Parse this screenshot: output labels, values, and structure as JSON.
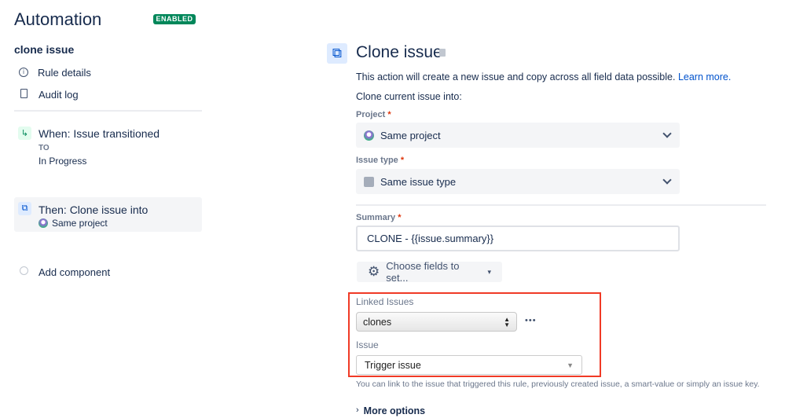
{
  "header": {
    "title": "Automation",
    "status_badge": "ENABLED"
  },
  "sidebar": {
    "rule_name": "clone issue",
    "nav": [
      {
        "label": "Rule details",
        "icon": "info-icon"
      },
      {
        "label": "Audit log",
        "icon": "document-icon"
      }
    ],
    "trigger": {
      "title": "When: Issue transitioned",
      "sub_label": "TO",
      "sub_value": "In Progress"
    },
    "action": {
      "title": "Then: Clone issue into",
      "project": "Same project"
    },
    "add_component": "Add component"
  },
  "main": {
    "title": "Clone issue",
    "description": "This action will create a new issue and copy across all field data possible.",
    "learn_more": "Learn more.",
    "clone_into": "Clone current issue into:",
    "project": {
      "label": "Project",
      "required": "*",
      "value": "Same project"
    },
    "issue_type": {
      "label": "Issue type",
      "required": "*",
      "value": "Same issue type"
    },
    "summary": {
      "label": "Summary",
      "required": "*",
      "value": "CLONE - {{issue.summary}}"
    },
    "choose_fields": "Choose fields to set...",
    "linked_issues": {
      "label": "Linked Issues",
      "value": "clones",
      "more": "•••"
    },
    "issue": {
      "label": "Issue",
      "value": "Trigger issue"
    },
    "help": "You can link to the issue that triggered this rule, previously created issue, a smart-value or simply an issue key.",
    "more_options": "More options"
  },
  "colors": {
    "accent": "#0052cc",
    "enabled": "#00875a",
    "highlight": "#f03a26"
  }
}
